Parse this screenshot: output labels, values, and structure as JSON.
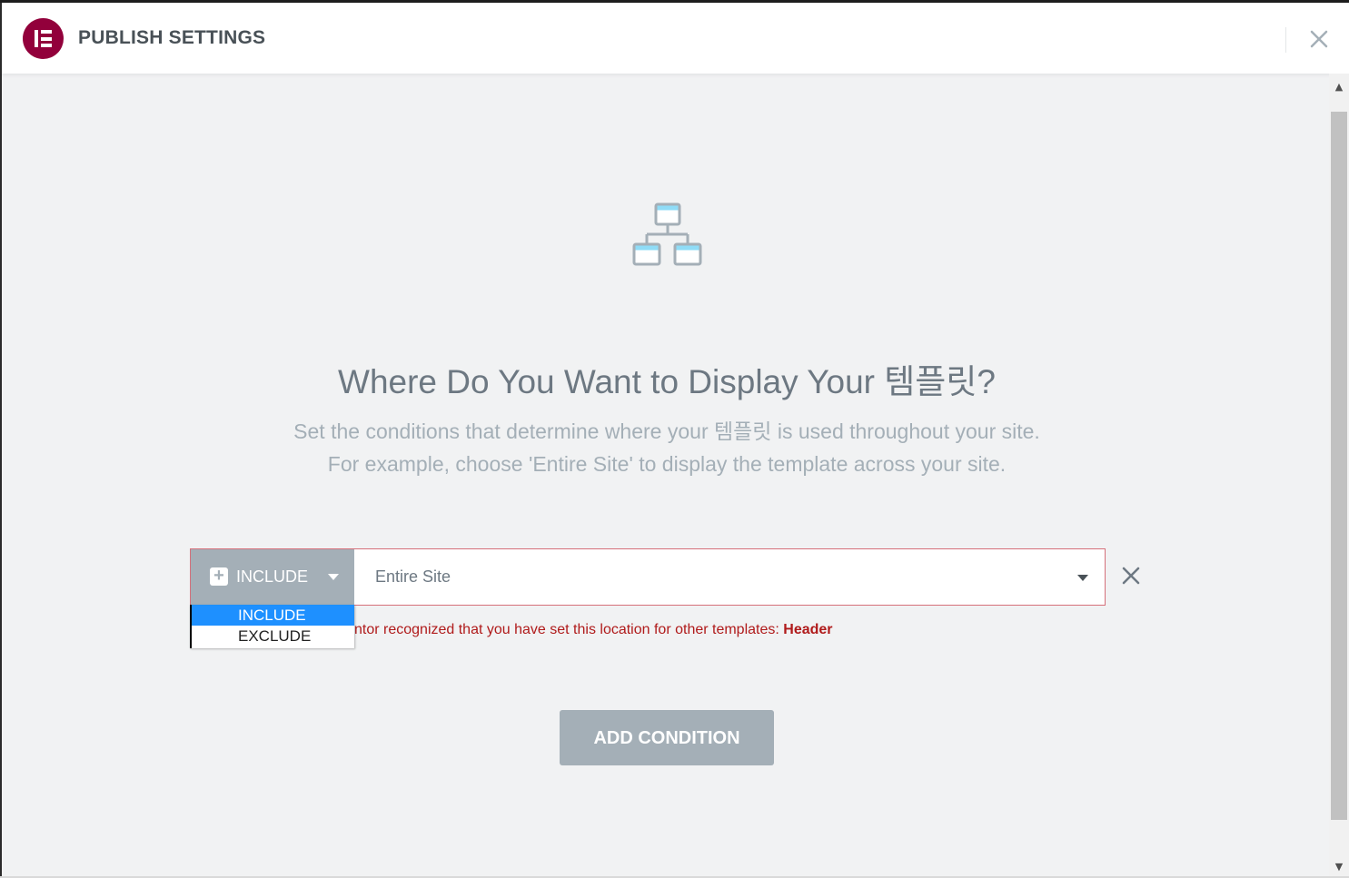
{
  "header": {
    "title": "PUBLISH SETTINGS",
    "logo_icon": "elementor-logo",
    "close_icon": "close-icon"
  },
  "main": {
    "title": "Where Do You Want to Display Your 템플릿?",
    "subtitle_line1": "Set the conditions that determine where your 템플릿 is used throughout your site.",
    "subtitle_line2": "For example, choose 'Entire Site' to display the template across your site."
  },
  "condition": {
    "type_label": "INCLUDE",
    "location_value": "Entire Site",
    "dropdown_options": [
      "INCLUDE",
      "EXCLUDE"
    ],
    "selected_option": "INCLUDE",
    "warning_text": "ntor recognized that you have set this location for other templates: ",
    "warning_link": "Header"
  },
  "actions": {
    "add_condition_label": "ADD CONDITION"
  },
  "colors": {
    "brand": "#92003b",
    "muted": "#a4afb7",
    "warning": "#b01b1b",
    "highlight": "#1e90ff"
  }
}
